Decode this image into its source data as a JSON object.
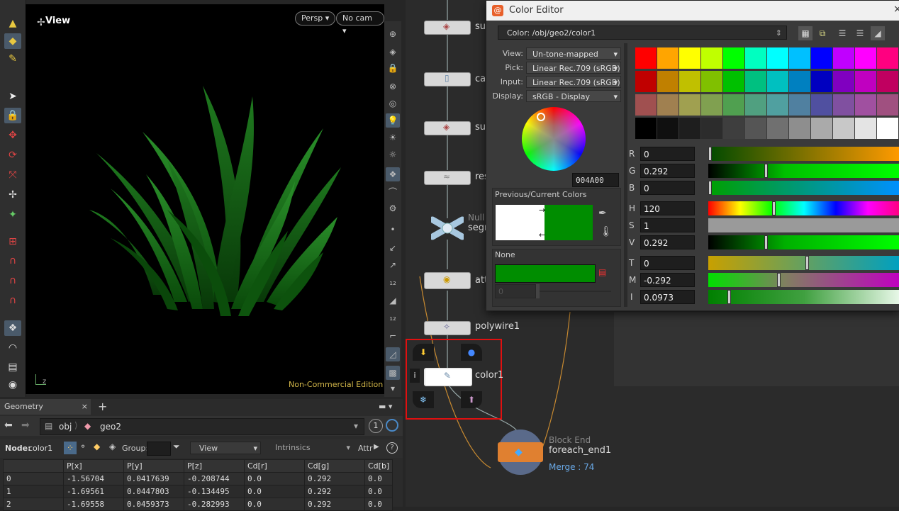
{
  "viewport": {
    "title": "View",
    "persp_label": "Persp",
    "cam_label": "No cam",
    "watermark": "Non-Commercial Edition",
    "axis_label": "z"
  },
  "spreadsheet": {
    "tab_label": "Geometry Spreadsheet",
    "path": [
      "obj",
      "geo2"
    ],
    "path_count": "1",
    "node_label": "Node:",
    "node_value": "color1",
    "group_label": "Group:",
    "view_label": "View",
    "intrinsics_label": "Intrinsics",
    "attr_label": "Attr",
    "columns": [
      "",
      "P[x]",
      "P[y]",
      "P[z]",
      "Cd[r]",
      "Cd[g]",
      "Cd[b]"
    ],
    "rows": [
      [
        "0",
        "-1.56704",
        "0.0417639",
        "-0.208744",
        "0.0",
        "0.292",
        "0.0"
      ],
      [
        "1",
        "-1.69561",
        "0.0447803",
        "-0.134495",
        "0.0",
        "0.292",
        "0.0"
      ],
      [
        "2",
        "-1.69558",
        "0.0459373",
        "-0.282993",
        "0.0",
        "0.292",
        "0.0"
      ]
    ]
  },
  "network": {
    "nodes": [
      {
        "label": "su"
      },
      {
        "label": "ca"
      },
      {
        "label": "su"
      },
      {
        "label": "res"
      },
      {
        "label": "segm",
        "type": "Null"
      },
      {
        "label": "att"
      },
      {
        "label": "polywire1"
      },
      {
        "label": "color1"
      }
    ],
    "block_end": {
      "type": "Block End",
      "name": "foreach_end1",
      "merge": "Merge : 74"
    }
  },
  "color_editor": {
    "title": "Color Editor",
    "path": "Color: /obj/geo2/color1",
    "view_label": "View:",
    "view_value": "Un-tone-mapped",
    "pick_label": "Pick:",
    "pick_value": "Linear Rec.709 (sRGB)",
    "input_label": "Input:",
    "input_value": "Linear Rec.709 (sRGB)",
    "display_label": "Display:",
    "display_value": "sRGB - Display",
    "hex": "004A00",
    "prev_current_label": "Previous/Current Colors",
    "none_label": "None",
    "none_value": "0",
    "previous_color": "#ffffff",
    "current_color": "#008d00",
    "channels": [
      {
        "label": "R",
        "value": "0"
      },
      {
        "label": "G",
        "value": "0.292"
      },
      {
        "label": "B",
        "value": "0"
      },
      {
        "label": "H",
        "value": "120"
      },
      {
        "label": "S",
        "value": "1"
      },
      {
        "label": "V",
        "value": "0.292"
      },
      {
        "label": "T",
        "value": "0"
      },
      {
        "label": "M",
        "value": "-0.292"
      },
      {
        "label": "I",
        "value": "0.0973"
      }
    ],
    "palette": [
      [
        "#ff0000",
        "#ffa500",
        "#ffff00",
        "#c0ff00",
        "#00ff00",
        "#00ffc0",
        "#00ffff",
        "#00c0ff",
        "#0000ff",
        "#c000ff",
        "#ff00ff",
        "#ff0080"
      ],
      [
        "#c00000",
        "#c08000",
        "#c0c000",
        "#80c000",
        "#00c000",
        "#00c080",
        "#00c0c0",
        "#0080c0",
        "#0000c0",
        "#8000c0",
        "#c000c0",
        "#c00060"
      ],
      [
        "#a05050",
        "#a08050",
        "#a0a050",
        "#80a050",
        "#50a050",
        "#50a080",
        "#50a0a0",
        "#5080a0",
        "#5050a0",
        "#8050a0",
        "#a050a0",
        "#a05080"
      ],
      [
        "#000000",
        "#101010",
        "#1e1e1e",
        "#2c2c2c",
        "#3e3e3e",
        "#555555",
        "#707070",
        "#8e8e8e",
        "#aaaaaa",
        "#c8c8c8",
        "#e4e4e4",
        "#ffffff"
      ]
    ]
  }
}
